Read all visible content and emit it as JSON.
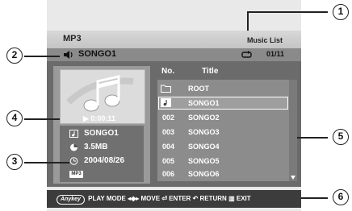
{
  "screen": {
    "mode_title": "MP3",
    "list_title": "Music List",
    "now_playing": "SONGO1",
    "track_counter": "01/11"
  },
  "player": {
    "play_time": "0:00:11",
    "song_name": "SONGO1",
    "file_size": "3.5MB",
    "date": "2004/08/26",
    "format_tag": "MP3"
  },
  "list": {
    "header_no": "No.",
    "header_title": "Title",
    "rows": [
      {
        "no": "",
        "title": "ROOT",
        "icon": "folder-icon"
      },
      {
        "no": "",
        "title": "SONGO1",
        "icon": "music-note-icon",
        "selected": true
      },
      {
        "no": "002",
        "title": "SONGO2"
      },
      {
        "no": "003",
        "title": "SONGO3"
      },
      {
        "no": "004",
        "title": "SONGO4"
      },
      {
        "no": "005",
        "title": "SONGO5"
      },
      {
        "no": "006",
        "title": "SONGO6"
      }
    ]
  },
  "footer": {
    "anykey": "Anykey",
    "play_mode": "PLAY MODE",
    "move": "MOVE",
    "enter": "ENTER",
    "return": "RETURN",
    "exit": "EXIT"
  },
  "callouts": [
    "1",
    "2",
    "3",
    "4",
    "5",
    "6"
  ]
}
